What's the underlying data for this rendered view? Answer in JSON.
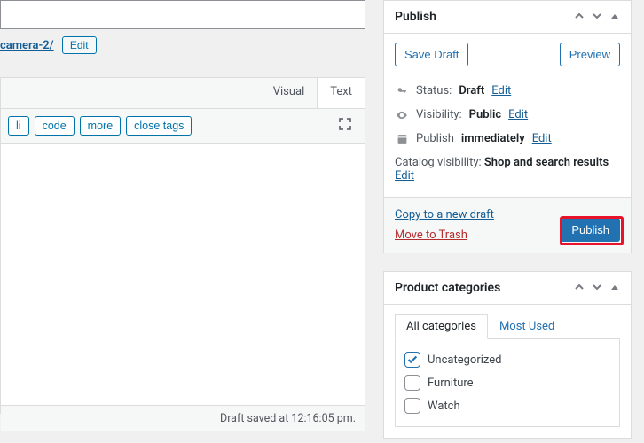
{
  "permalink": {
    "slug": "camera-2/",
    "edit_label": "Edit"
  },
  "editor": {
    "tabs": {
      "visual": "Visual",
      "text": "Text"
    },
    "buttons": {
      "li": "li",
      "code": "code",
      "more": "more",
      "close_tags": "close tags"
    },
    "footer": "Draft saved at 12:16:05 pm."
  },
  "publish": {
    "title": "Publish",
    "save_draft": "Save Draft",
    "preview": "Preview",
    "status": {
      "label": "Status:",
      "value": "Draft",
      "edit": "Edit"
    },
    "visibility": {
      "label": "Visibility:",
      "value": "Public",
      "edit": "Edit"
    },
    "schedule": {
      "label": "Publish",
      "value": "immediately",
      "edit": "Edit"
    },
    "catalog": {
      "label": "Catalog visibility:",
      "value": "Shop and search results",
      "edit": "Edit"
    },
    "copy_link": "Copy to a new draft",
    "trash_link": "Move to Trash",
    "publish_btn": "Publish"
  },
  "categories": {
    "title": "Product categories",
    "tabs": {
      "all": "All categories",
      "most": "Most Used"
    },
    "items": [
      {
        "label": "Uncategorized",
        "checked": true
      },
      {
        "label": "Furniture",
        "checked": false
      },
      {
        "label": "Watch",
        "checked": false
      }
    ]
  }
}
